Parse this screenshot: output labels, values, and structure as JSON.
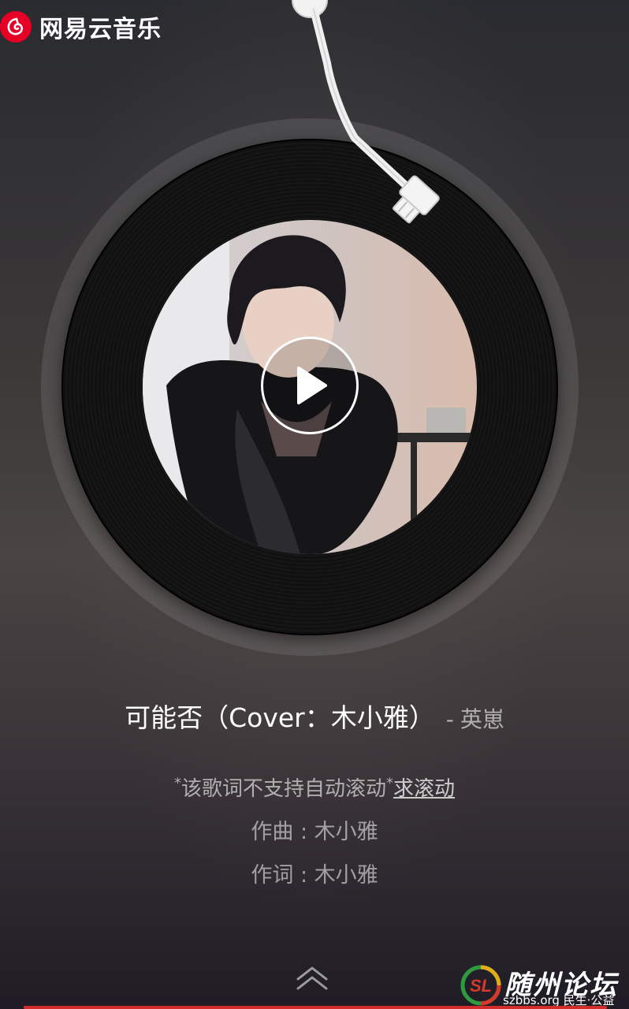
{
  "app": {
    "name": "网易云音乐",
    "brand_color": "#e60026"
  },
  "player": {
    "cover_alt": "cover",
    "play_icon": "play-icon"
  },
  "song": {
    "title": "可能否（Cover：木小雅）",
    "separator": "-",
    "artist": "英崽"
  },
  "lyrics": {
    "star": "*",
    "notice": "该歌词不支持自动滚动",
    "request_scroll": "求滚动",
    "composer": "作曲 : 木小雅",
    "lyricist": "作词 : 木小雅"
  },
  "watermark": {
    "title": "随州论坛",
    "subtitle": "szbbs.org 民生·公益"
  },
  "colors": {
    "accent": "#d42b2b",
    "text_primary": "#ffffff",
    "text_secondary": "#a9a5a6"
  }
}
